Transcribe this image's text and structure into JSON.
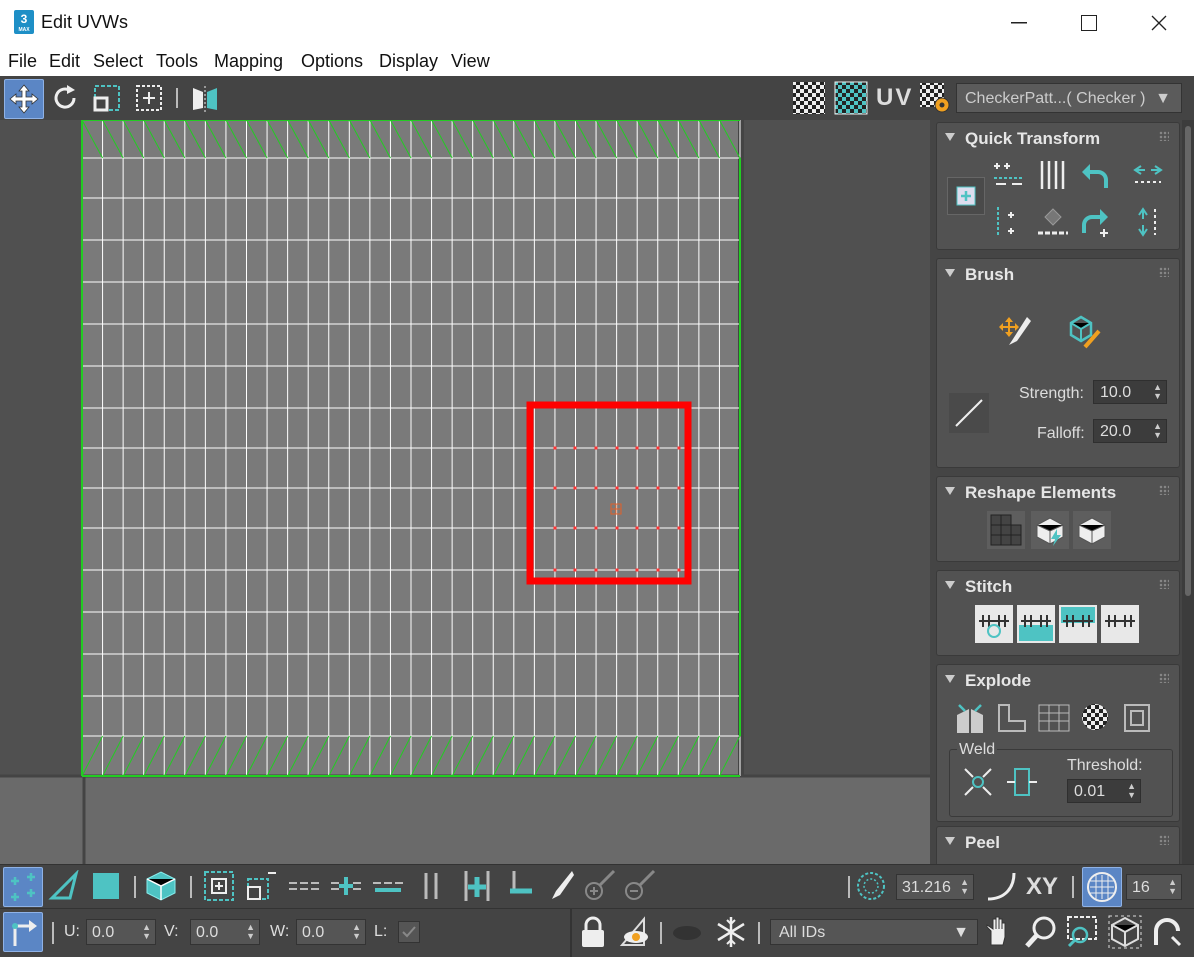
{
  "window": {
    "title": "Edit UVWs",
    "app_badge": "3",
    "app_sub": "MAX"
  },
  "menu": [
    "File",
    "Edit",
    "Select",
    "Tools",
    "Mapping",
    "Options",
    "Display",
    "View"
  ],
  "toolbar": {
    "uv_label": "UV",
    "texture_dropdown": "CheckerPatt...( Checker )"
  },
  "panel": {
    "quick_transform": {
      "title": "Quick Transform"
    },
    "brush": {
      "title": "Brush",
      "strength_label": "Strength:",
      "strength_value": "10.0",
      "falloff_label": "Falloff:",
      "falloff_value": "20.0"
    },
    "reshape": {
      "title": "Reshape Elements"
    },
    "stitch": {
      "title": "Stitch"
    },
    "explode": {
      "title": "Explode",
      "weld_label": "Weld",
      "threshold_label": "Threshold:",
      "threshold_value": "0.01"
    },
    "peel": {
      "title": "Peel"
    }
  },
  "bottom1": {
    "soft_value": "31.216",
    "xy_label": "XY",
    "grid_value": "16"
  },
  "bottom2": {
    "u_label": "U:",
    "u_value": "0.0",
    "v_label": "V:",
    "v_value": "0.0",
    "w_label": "W:",
    "w_value": "0.0",
    "l_label": "L:",
    "ids_dropdown": "All IDs"
  },
  "colors": {
    "accent": "#4ec3c3",
    "selection_box": "#ff0000",
    "seam": "#22cc22",
    "grid": "#ffffff",
    "viewport_bg": "#5a5a5a"
  }
}
